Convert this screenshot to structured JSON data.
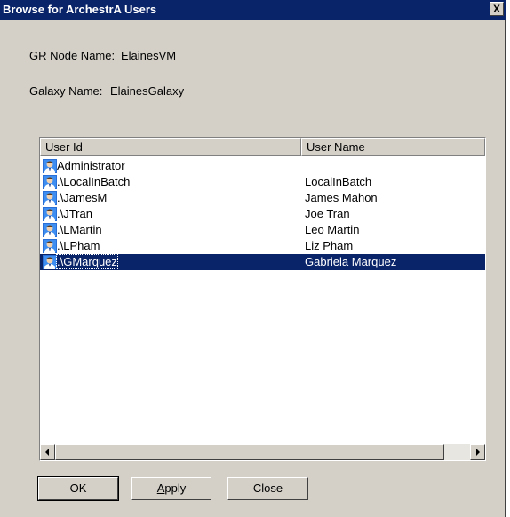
{
  "window": {
    "title": "Browse for ArchestrA Users",
    "close_glyph": "X"
  },
  "info": {
    "node_label": "GR Node Name:",
    "node_value": "ElainesVM",
    "galaxy_label": "Galaxy Name:",
    "galaxy_value": "ElainesGalaxy"
  },
  "table": {
    "columns": [
      "User Id",
      "User Name"
    ],
    "rows": [
      {
        "user_id": "Administrator",
        "user_name": ""
      },
      {
        "user_id": ".\\LocalInBatch",
        "user_name": "LocalInBatch"
      },
      {
        "user_id": ".\\JamesM",
        "user_name": "James Mahon"
      },
      {
        "user_id": ".\\JTran",
        "user_name": "Joe Tran"
      },
      {
        "user_id": ".\\LMartin",
        "user_name": "Leo Martin"
      },
      {
        "user_id": ".\\LPham",
        "user_name": "Liz Pham"
      },
      {
        "user_id": ".\\GMarquez",
        "user_name": "Gabriela Marquez"
      }
    ],
    "selected_row": 6,
    "row_icon": "user-icon"
  },
  "buttons": {
    "ok": "OK",
    "apply_first": "A",
    "apply_rest": "pply",
    "close": "Close"
  },
  "colors": {
    "selection": "#0a246a",
    "face": "#d4d0c8",
    "title_bar": "#0a246a"
  }
}
